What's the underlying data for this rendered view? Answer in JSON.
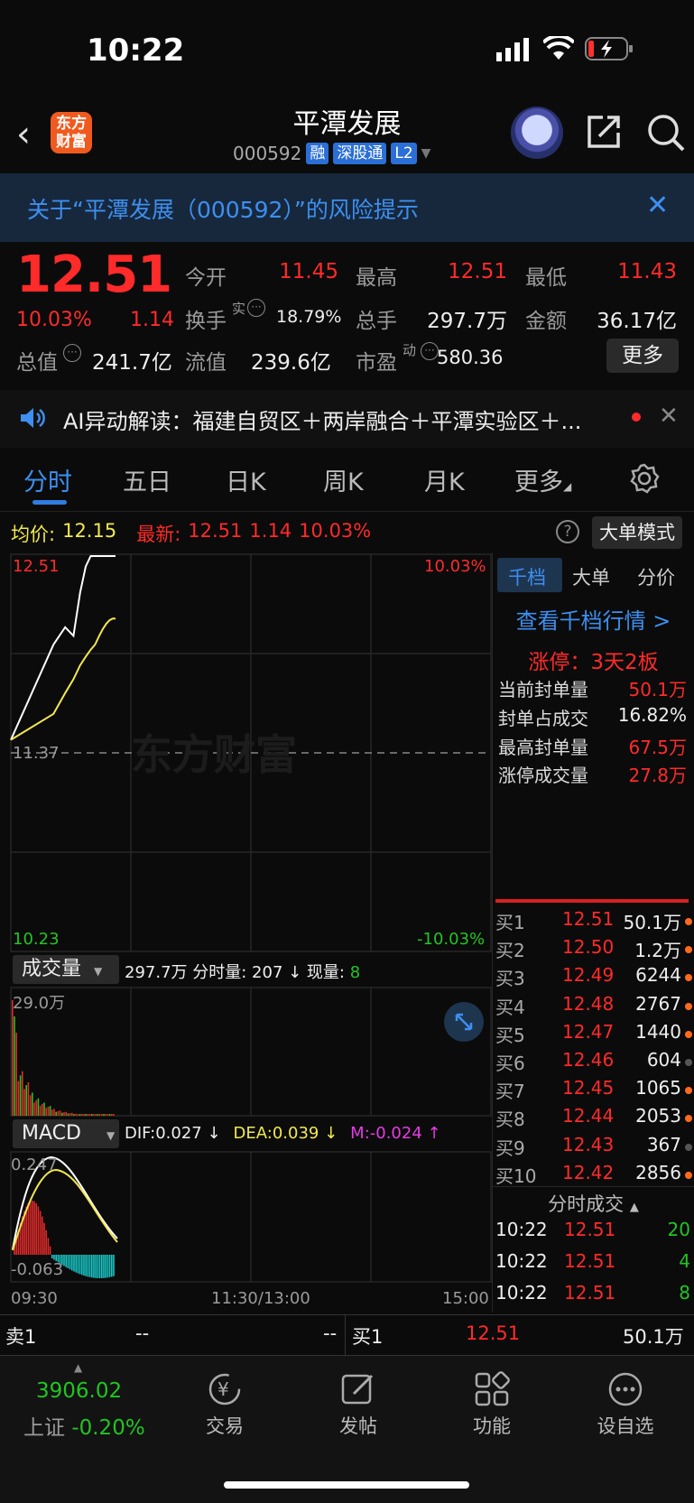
{
  "status": {
    "time": "10:22"
  },
  "header": {
    "logo": "东方\n财富",
    "name": "平潭发展",
    "code": "000592",
    "tags": [
      "融",
      "深股通",
      "L2"
    ]
  },
  "risk": {
    "text": "关于“平潭发展（000592）”的风险提示"
  },
  "quote": {
    "price": "12.51",
    "pct": "10.03%",
    "chg": "1.14",
    "open_label": "今开",
    "open": "11.45",
    "high_label": "最高",
    "high": "12.51",
    "low_label": "最低",
    "low": "11.43",
    "turnover_label": "换手",
    "turnover_sup": "实",
    "turnover": "18.79%",
    "volume_label": "总手",
    "volume": "297.7万",
    "amount_label": "金额",
    "amount": "36.17亿",
    "mcap_label": "总值",
    "mcap": "241.7亿",
    "float_label": "流值",
    "float": "239.6亿",
    "pe_label": "市盈",
    "pe_sup": "动",
    "pe": "580.36",
    "more": "更多"
  },
  "ai": {
    "text": "AI异动解读：福建自贸区＋两岸融合＋平潭实验区＋..."
  },
  "tabs": [
    "分时",
    "五日",
    "日K",
    "周K",
    "月K",
    "更多"
  ],
  "avgrow": {
    "avg_label": "均价:",
    "avg": "12.15",
    "last_label": "最新:",
    "last": "12.51",
    "chg": "1.14",
    "pct": "10.03%",
    "help": "?",
    "bigorder": "大单模式"
  },
  "chart": {
    "ylabel_top": "12.51",
    "ylabel_mid": "11.37",
    "ylabel_bottom": "10.23",
    "pct_top": "10.03%",
    "pct_bottom": "-10.03%",
    "watermark": "东方财富",
    "vol_selector": "成交量",
    "vol_info": "297.7万 分时量: 207 ↓ 现量:",
    "vol_now": "8",
    "vol_max": "29.0万",
    "macd_selector": "MACD",
    "dif": "DIF:0.027 ↓",
    "dea": "DEA:0.039 ↓",
    "m": "M:-0.024 ↑",
    "macd_top": "0.247",
    "macd_bottom": "-0.063",
    "time_start": "09:30",
    "time_mid": "11:30/13:00",
    "time_end": "15:00"
  },
  "chart_data": {
    "type": "line",
    "x": [
      "09:30",
      "09:31",
      "09:32",
      "09:33",
      "09:34",
      "09:35",
      "09:36",
      "09:38",
      "09:40",
      "09:45",
      "09:50",
      "10:00",
      "10:10",
      "10:22"
    ],
    "series": [
      {
        "values": [
          11.45,
          12.0,
          12.1,
          12.05,
          12.3,
          12.45,
          12.51,
          12.51,
          12.51,
          12.51,
          12.51,
          12.51,
          12.51,
          12.51
        ]
      },
      {
        "values": [
          11.45,
          11.6,
          11.72,
          11.8,
          11.88,
          11.93,
          11.97,
          12.0,
          12.05,
          12.09,
          12.12,
          12.14,
          12.15,
          12.15
        ]
      }
    ],
    "ylim": [
      10.23,
      12.51
    ]
  },
  "right": {
    "tabs": [
      "千档",
      "大单",
      "分价"
    ],
    "link": "查看千档行情 >",
    "limit": "涨停：3天2板",
    "stats": [
      {
        "label": "当前封单量",
        "value": "50.1万"
      },
      {
        "label": "封单占成交",
        "value": "16.82%"
      },
      {
        "label": "最高封单量",
        "value": "67.5万"
      },
      {
        "label": "涨停成交量",
        "value": "27.8万"
      }
    ],
    "bids": [
      {
        "label": "买1",
        "price": "12.51",
        "vol": "50.1万",
        "dot": "#ff6a1a"
      },
      {
        "label": "买2",
        "price": "12.50",
        "vol": "1.2万",
        "dot": "#ff6a1a"
      },
      {
        "label": "买3",
        "price": "12.49",
        "vol": "6244",
        "dot": "#ff6a1a"
      },
      {
        "label": "买4",
        "price": "12.48",
        "vol": "2767",
        "dot": "#ff6a1a"
      },
      {
        "label": "买5",
        "price": "12.47",
        "vol": "1440",
        "dot": "#ff6a1a"
      },
      {
        "label": "买6",
        "price": "12.46",
        "vol": "604",
        "dot": "#555"
      },
      {
        "label": "买7",
        "price": "12.45",
        "vol": "1065",
        "dot": "#ff6a1a"
      },
      {
        "label": "买8",
        "price": "12.44",
        "vol": "2053",
        "dot": "#ff6a1a"
      },
      {
        "label": "买9",
        "price": "12.43",
        "vol": "367",
        "dot": "#555"
      },
      {
        "label": "买10",
        "price": "12.42",
        "vol": "2856",
        "dot": "#ff6a1a"
      }
    ],
    "ticks_title": "分时成交",
    "ticks": [
      {
        "time": "10:22",
        "price": "12.51",
        "vol": "20"
      },
      {
        "time": "10:22",
        "price": "12.51",
        "vol": "4"
      },
      {
        "time": "10:22",
        "price": "12.51",
        "vol": "8"
      }
    ]
  },
  "quotebar": {
    "sell_label": "卖1",
    "sell_price": "--",
    "sell_vol": "--",
    "buy_label": "买1",
    "buy_price": "12.51",
    "buy_vol": "50.1万"
  },
  "nav": {
    "index_value": "3906.02",
    "index_name": "上证",
    "index_pct": "-0.20%",
    "items": [
      "交易",
      "发帖",
      "功能",
      "设自选"
    ]
  }
}
